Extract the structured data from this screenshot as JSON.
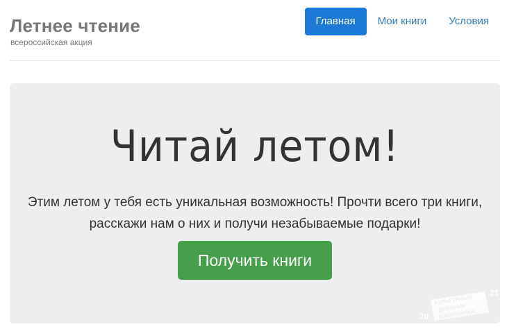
{
  "brand": {
    "title": "Летнее чтение",
    "subtitle": "всероссийская акция"
  },
  "nav": {
    "items": [
      {
        "label": "Главная",
        "active": true
      },
      {
        "label": "Мои книги",
        "active": false
      },
      {
        "label": "Условия",
        "active": false
      }
    ]
  },
  "hero": {
    "title": "Читай летом!",
    "lead_line1": "Этим летом у тебя есть уникальная возможность! Прочти всего три книги,",
    "lead_line2": "расскажи нам о них и получи незабываемые подарки!",
    "cta_label": "Получить книги"
  },
  "watermark": {
    "line1": "КУЛЬТУРНЫЙ",
    "line2": "ДНЕВНИК",
    "line3": "ШКОЛЬНИКА",
    "year_left": "20",
    "year_right": "21"
  },
  "colors": {
    "accent": "#1c7ad6",
    "link": "#337ab7",
    "cta": "#46a049",
    "jumbotron_bg": "#eceeef"
  }
}
